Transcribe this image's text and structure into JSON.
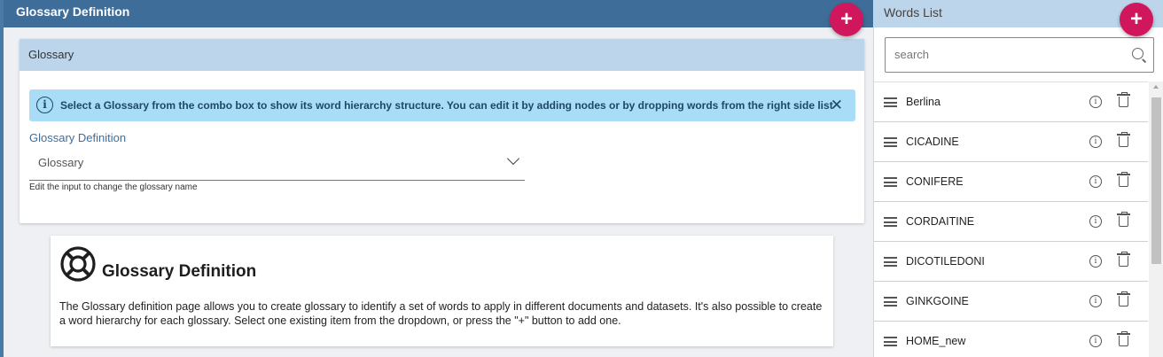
{
  "header": {
    "title": "Glossary Definition",
    "add_label": "+"
  },
  "card": {
    "title": "Glossary",
    "info_text": "Select a Glossary from the combo box to show its word hierarchy structure. You can edit it by adding nodes or by dropping words from the right side list",
    "info_icon": "i",
    "close_icon": "✕",
    "field_label": "Glossary Definition",
    "select_value": "Glossary",
    "hint": "Edit the input to change the glossary name"
  },
  "doc": {
    "title": "Glossary Definition",
    "text": "The Glossary definition page allows you to create glossary to identify a set of words to apply in different documents and datasets. It's also possible to create a word hierarchy for each glossary. Select one existing item from the dropdown, or press the \"+\" button to add one."
  },
  "words": {
    "title": "Words List",
    "add_label": "+",
    "search_placeholder": "search",
    "items": [
      {
        "label": "Berlina"
      },
      {
        "label": "CICADINE"
      },
      {
        "label": "CONIFERE"
      },
      {
        "label": "CORDAITINE"
      },
      {
        "label": "DICOTILEDONI"
      },
      {
        "label": "GINKGOINE"
      },
      {
        "label": "HOME_new"
      }
    ]
  },
  "colors": {
    "accent": "#d0165c",
    "header": "#3f6d99",
    "card_header": "#bcd5eb",
    "info_bg": "#a9dcf7"
  }
}
